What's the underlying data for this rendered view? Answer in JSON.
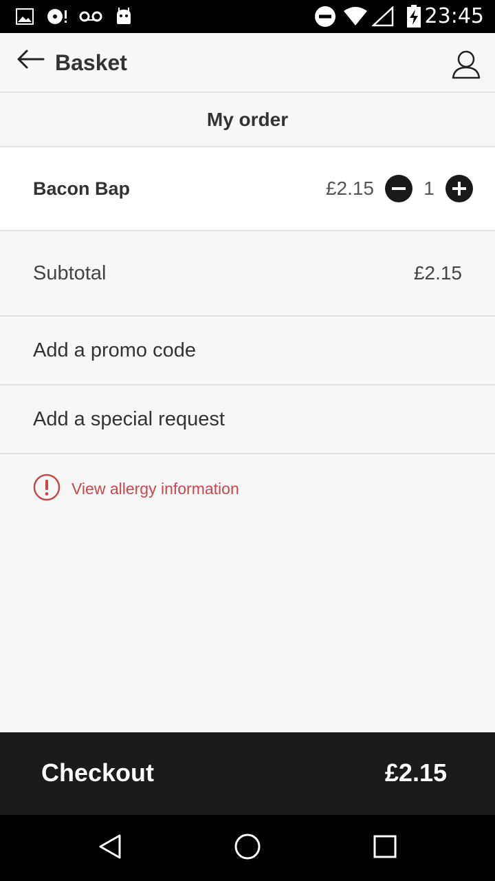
{
  "status_bar": {
    "time": "23:45",
    "icons": [
      "image-icon",
      "sync-disc-icon",
      "voicemail-icon",
      "android-icon",
      "do-not-disturb-icon",
      "wifi-icon",
      "signal-icon",
      "battery-charging-icon"
    ]
  },
  "app_bar": {
    "title": "Basket",
    "back_icon": "arrow-left-icon",
    "account_icon": "user-icon"
  },
  "order": {
    "section_title": "My order",
    "items": [
      {
        "name": "Bacon Bap",
        "price": "£2.15",
        "quantity": "1"
      }
    ],
    "subtotal_label": "Subtotal",
    "subtotal_value": "£2.15"
  },
  "actions": {
    "promo_label": "Add a promo code",
    "request_label": "Add a special request",
    "allergy_label": "View allergy information"
  },
  "checkout": {
    "label": "Checkout",
    "total": "£2.15"
  },
  "nav_bar": {
    "buttons": [
      "back-triangle-icon",
      "home-circle-icon",
      "recents-square-icon"
    ]
  },
  "colors": {
    "accent_alert": "#c9474a",
    "checkout_bg": "#1b1b1b",
    "page_bg": "#f7f7f7"
  }
}
